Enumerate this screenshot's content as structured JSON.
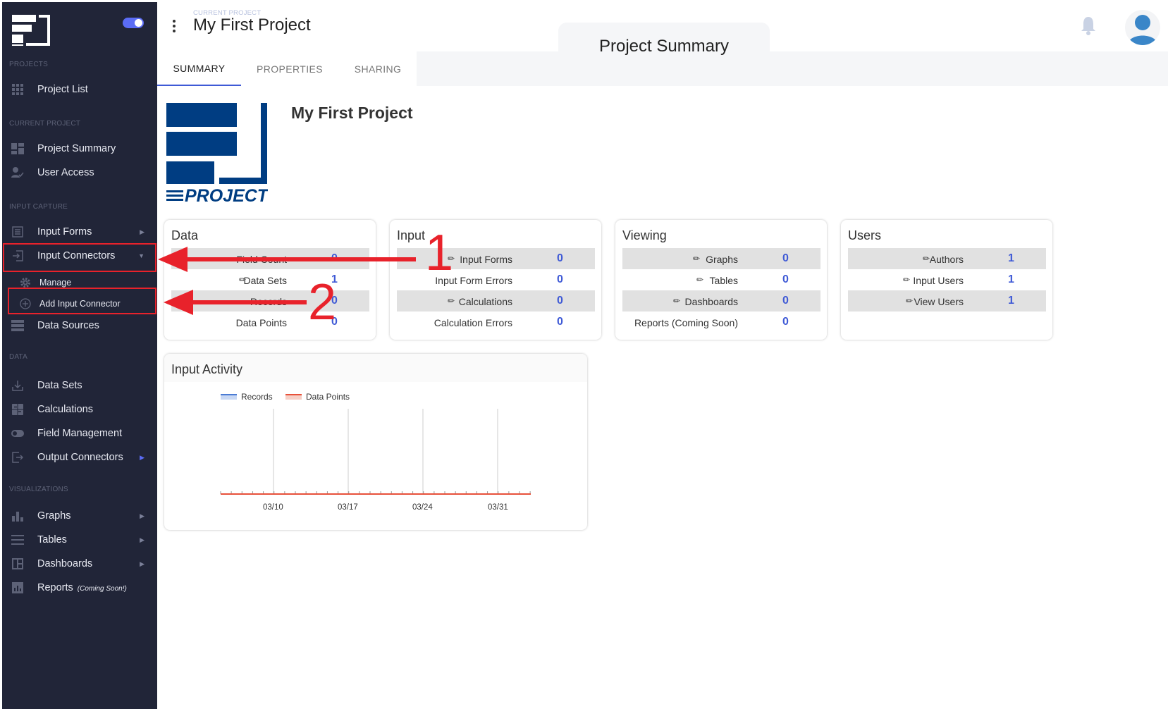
{
  "sidebar": {
    "sections": {
      "projects": "PROJECTS",
      "current_project": "CURRENT PROJECT",
      "input_capture": "INPUT CAPTURE",
      "data": "DATA",
      "visualizations": "VISUALIZATIONS"
    },
    "items": {
      "project_list": "Project List",
      "project_summary": "Project Summary",
      "user_access": "User Access",
      "input_forms": "Input Forms",
      "input_connectors": "Input Connectors",
      "manage": "Manage",
      "add_input_connector": "Add Input Connector",
      "data_sources": "Data Sources",
      "data_sets": "Data Sets",
      "calculations": "Calculations",
      "field_management": "Field Management",
      "output_connectors": "Output Connectors",
      "graphs": "Graphs",
      "tables": "Tables",
      "dashboards": "Dashboards",
      "reports": "Reports",
      "reports_note": "(Coming Soon!)"
    },
    "accent_color": "#5b6cf5"
  },
  "header": {
    "breadcrumb": "CURRENT PROJECT",
    "title": "My First Project",
    "page_title": "Project Summary"
  },
  "tabs": [
    "SUMMARY",
    "PROPERTIES",
    "SHARING"
  ],
  "project": {
    "name": "My First Project",
    "logo_text": "PROJECT"
  },
  "cards": {
    "data": {
      "title": "Data",
      "rows": [
        {
          "label": "Field Count",
          "value": "0"
        },
        {
          "label": "Data Sets",
          "value": "1"
        },
        {
          "label": "Records",
          "value": "0"
        },
        {
          "label": "Data Points",
          "value": "0"
        }
      ]
    },
    "input": {
      "title": "Input",
      "rows": [
        {
          "label": "Input Forms",
          "value": "0"
        },
        {
          "label": "Input Form Errors",
          "value": "0"
        },
        {
          "label": "Calculations",
          "value": "0"
        },
        {
          "label": "Calculation Errors",
          "value": "0"
        }
      ]
    },
    "viewing": {
      "title": "Viewing",
      "rows": [
        {
          "label": "Graphs",
          "value": "0"
        },
        {
          "label": "Tables",
          "value": "0"
        },
        {
          "label": "Dashboards",
          "value": "0"
        },
        {
          "label": "Reports (Coming Soon)",
          "value": "0"
        }
      ]
    },
    "users": {
      "title": "Users",
      "rows": [
        {
          "label": "Authors",
          "value": "1"
        },
        {
          "label": "Input Users",
          "value": "1"
        },
        {
          "label": "View Users",
          "value": "1"
        }
      ]
    }
  },
  "activity": {
    "title": "Input Activity",
    "legend": [
      "Records",
      "Data Points"
    ]
  },
  "chart_data": {
    "type": "line",
    "x_ticks": [
      "03/10",
      "03/17",
      "03/24",
      "03/31"
    ],
    "series": [
      {
        "name": "Records",
        "values": [
          0,
          0,
          0,
          0
        ],
        "color": "#4a7bd4"
      },
      {
        "name": "Data Points",
        "values": [
          0,
          0,
          0,
          0
        ],
        "color": "#e8513a"
      }
    ],
    "title": "Input Activity",
    "grid": true,
    "legend_position": "top-left"
  },
  "annotations": [
    "1",
    "2"
  ],
  "colors": {
    "link_value": "#3f5ad6",
    "highlight": "#e8222b",
    "brand_blue": "#003d82"
  }
}
